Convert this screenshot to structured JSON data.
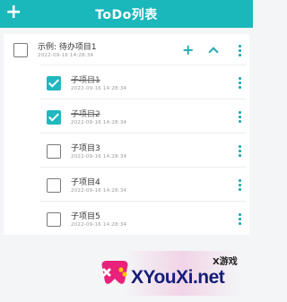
{
  "header": {
    "title": "ToDo列表",
    "add_icon": "plus-icon",
    "color": "#1ab7bb"
  },
  "parent": {
    "title": "示例: 待办项目1",
    "timestamp": "2022-09-16 14:28:34",
    "checked": false,
    "add_icon": "plus-icon",
    "collapse_icon": "chevron-up-icon",
    "menu_icon": "kebab-icon"
  },
  "children": [
    {
      "title": "子项目1",
      "timestamp": "2022-09-16 14:28:34",
      "checked": true
    },
    {
      "title": "子项目2",
      "timestamp": "2022-09-16 14:28:34",
      "checked": true
    },
    {
      "title": "子项目3",
      "timestamp": "2022-09-16 14:28:34",
      "checked": false
    },
    {
      "title": "子项目4",
      "timestamp": "2022-09-16 14:28:34",
      "checked": false
    },
    {
      "title": "子项目5",
      "timestamp": "2022-09-16 14:28:34",
      "checked": false
    }
  ],
  "watermark": {
    "small_text": "X游戏",
    "big_text": "XYouXi.net"
  },
  "colors": {
    "accent": "#20b7c0",
    "background": "#f4f5f7"
  }
}
